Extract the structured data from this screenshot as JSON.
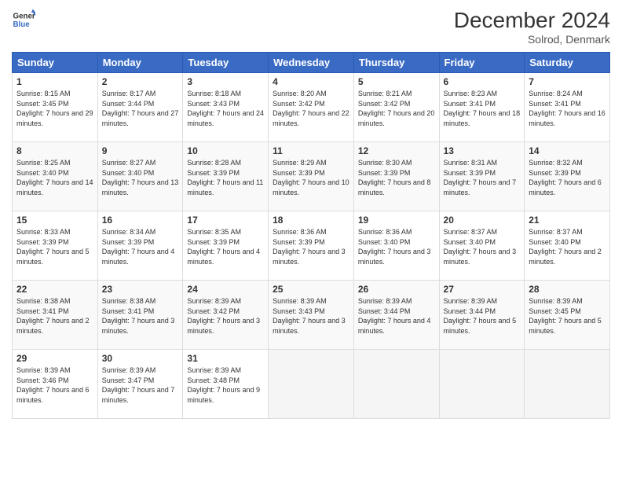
{
  "logo": {
    "line1": "General",
    "line2": "Blue"
  },
  "title": "December 2024",
  "subtitle": "Solrod, Denmark",
  "days_of_week": [
    "Sunday",
    "Monday",
    "Tuesday",
    "Wednesday",
    "Thursday",
    "Friday",
    "Saturday"
  ],
  "weeks": [
    [
      {
        "day": "1",
        "sunrise": "8:15 AM",
        "sunset": "3:45 PM",
        "daylight": "7 hours and 29 minutes."
      },
      {
        "day": "2",
        "sunrise": "8:17 AM",
        "sunset": "3:44 PM",
        "daylight": "7 hours and 27 minutes."
      },
      {
        "day": "3",
        "sunrise": "8:18 AM",
        "sunset": "3:43 PM",
        "daylight": "7 hours and 24 minutes."
      },
      {
        "day": "4",
        "sunrise": "8:20 AM",
        "sunset": "3:42 PM",
        "daylight": "7 hours and 22 minutes."
      },
      {
        "day": "5",
        "sunrise": "8:21 AM",
        "sunset": "3:42 PM",
        "daylight": "7 hours and 20 minutes."
      },
      {
        "day": "6",
        "sunrise": "8:23 AM",
        "sunset": "3:41 PM",
        "daylight": "7 hours and 18 minutes."
      },
      {
        "day": "7",
        "sunrise": "8:24 AM",
        "sunset": "3:41 PM",
        "daylight": "7 hours and 16 minutes."
      }
    ],
    [
      {
        "day": "8",
        "sunrise": "8:25 AM",
        "sunset": "3:40 PM",
        "daylight": "7 hours and 14 minutes."
      },
      {
        "day": "9",
        "sunrise": "8:27 AM",
        "sunset": "3:40 PM",
        "daylight": "7 hours and 13 minutes."
      },
      {
        "day": "10",
        "sunrise": "8:28 AM",
        "sunset": "3:39 PM",
        "daylight": "7 hours and 11 minutes."
      },
      {
        "day": "11",
        "sunrise": "8:29 AM",
        "sunset": "3:39 PM",
        "daylight": "7 hours and 10 minutes."
      },
      {
        "day": "12",
        "sunrise": "8:30 AM",
        "sunset": "3:39 PM",
        "daylight": "7 hours and 8 minutes."
      },
      {
        "day": "13",
        "sunrise": "8:31 AM",
        "sunset": "3:39 PM",
        "daylight": "7 hours and 7 minutes."
      },
      {
        "day": "14",
        "sunrise": "8:32 AM",
        "sunset": "3:39 PM",
        "daylight": "7 hours and 6 minutes."
      }
    ],
    [
      {
        "day": "15",
        "sunrise": "8:33 AM",
        "sunset": "3:39 PM",
        "daylight": "7 hours and 5 minutes."
      },
      {
        "day": "16",
        "sunrise": "8:34 AM",
        "sunset": "3:39 PM",
        "daylight": "7 hours and 4 minutes."
      },
      {
        "day": "17",
        "sunrise": "8:35 AM",
        "sunset": "3:39 PM",
        "daylight": "7 hours and 4 minutes."
      },
      {
        "day": "18",
        "sunrise": "8:36 AM",
        "sunset": "3:39 PM",
        "daylight": "7 hours and 3 minutes."
      },
      {
        "day": "19",
        "sunrise": "8:36 AM",
        "sunset": "3:40 PM",
        "daylight": "7 hours and 3 minutes."
      },
      {
        "day": "20",
        "sunrise": "8:37 AM",
        "sunset": "3:40 PM",
        "daylight": "7 hours and 3 minutes."
      },
      {
        "day": "21",
        "sunrise": "8:37 AM",
        "sunset": "3:40 PM",
        "daylight": "7 hours and 2 minutes."
      }
    ],
    [
      {
        "day": "22",
        "sunrise": "8:38 AM",
        "sunset": "3:41 PM",
        "daylight": "7 hours and 2 minutes."
      },
      {
        "day": "23",
        "sunrise": "8:38 AM",
        "sunset": "3:41 PM",
        "daylight": "7 hours and 3 minutes."
      },
      {
        "day": "24",
        "sunrise": "8:39 AM",
        "sunset": "3:42 PM",
        "daylight": "7 hours and 3 minutes."
      },
      {
        "day": "25",
        "sunrise": "8:39 AM",
        "sunset": "3:43 PM",
        "daylight": "7 hours and 3 minutes."
      },
      {
        "day": "26",
        "sunrise": "8:39 AM",
        "sunset": "3:44 PM",
        "daylight": "7 hours and 4 minutes."
      },
      {
        "day": "27",
        "sunrise": "8:39 AM",
        "sunset": "3:44 PM",
        "daylight": "7 hours and 5 minutes."
      },
      {
        "day": "28",
        "sunrise": "8:39 AM",
        "sunset": "3:45 PM",
        "daylight": "7 hours and 5 minutes."
      }
    ],
    [
      {
        "day": "29",
        "sunrise": "8:39 AM",
        "sunset": "3:46 PM",
        "daylight": "7 hours and 6 minutes."
      },
      {
        "day": "30",
        "sunrise": "8:39 AM",
        "sunset": "3:47 PM",
        "daylight": "7 hours and 7 minutes."
      },
      {
        "day": "31",
        "sunrise": "8:39 AM",
        "sunset": "3:48 PM",
        "daylight": "7 hours and 9 minutes."
      },
      null,
      null,
      null,
      null
    ]
  ]
}
